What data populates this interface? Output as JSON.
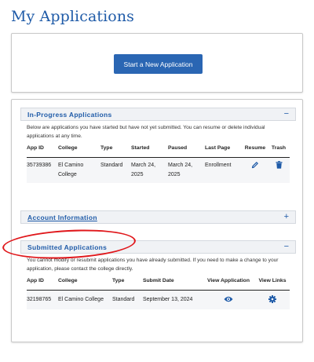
{
  "page": {
    "title": "My Applications"
  },
  "start": {
    "button_label": "Start a New Application"
  },
  "in_progress": {
    "title": "In-Progress Applications",
    "toggle": "−",
    "description": "Below are applications you have started but have not yet submitted. You can resume or delete individual applications at any time.",
    "columns": [
      "App ID",
      "College",
      "Type",
      "Started",
      "Paused",
      "Last Page",
      "Resume",
      "Trash"
    ],
    "rows": [
      {
        "app_id": "35739386",
        "college": "El Camino College",
        "type": "Standard",
        "started": "March 24, 2025",
        "paused": "March 24, 2025",
        "last_page": "Enrollment",
        "resume_icon": "pencil-icon",
        "trash_icon": "trash-icon"
      }
    ]
  },
  "account": {
    "title": "Account Information",
    "toggle": "+"
  },
  "submitted": {
    "title": "Submitted Applications",
    "toggle": "−",
    "description": "You cannot modify or resubmit applications you have already submitted. If you need to make a change to your application, please contact the college directly.",
    "columns": [
      "App ID",
      "College",
      "Type",
      "Submit Date",
      "View Application",
      "View Links"
    ],
    "rows": [
      {
        "app_id": "32198765",
        "college": "El Camino College",
        "type": "Standard",
        "submit_date": "September 13, 2024",
        "view_icon": "eye-icon",
        "links_icon": "gear-icon"
      }
    ]
  },
  "colors": {
    "brand": "#1f5ba8",
    "button": "#2a66b3",
    "annotation": "#e0171b"
  }
}
